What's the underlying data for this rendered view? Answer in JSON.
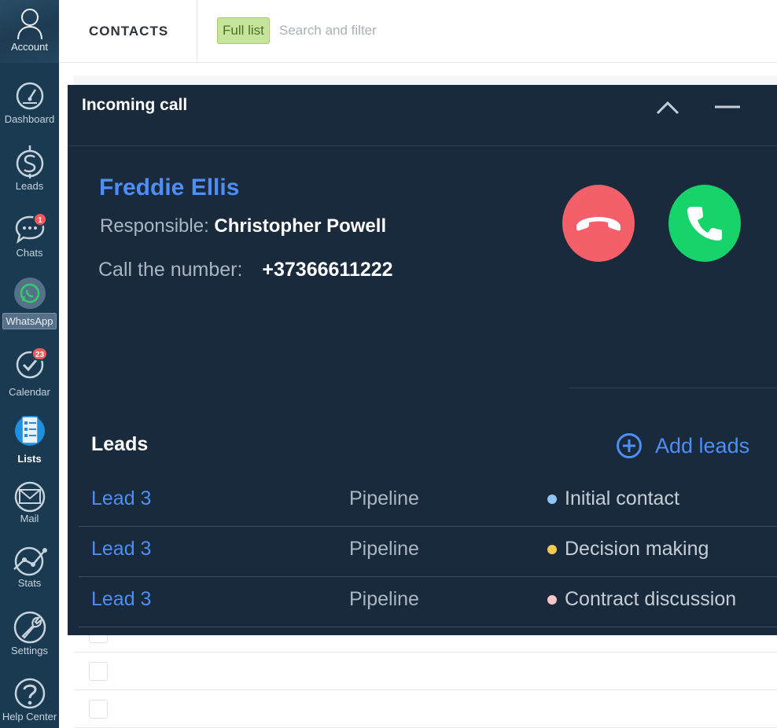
{
  "sidebar": {
    "account_label": "Account",
    "items": [
      {
        "label": "Dashboard",
        "icon": "gauge-icon"
      },
      {
        "label": "Leads",
        "icon": "dollar-icon"
      },
      {
        "label": "Chats",
        "icon": "chat-icon",
        "badge": "1"
      },
      {
        "label": "WhatsApp",
        "icon": "whatsapp-icon"
      },
      {
        "label": "Calendar",
        "icon": "check-icon",
        "badge": "23"
      },
      {
        "label": "Lists",
        "icon": "list-icon"
      },
      {
        "label": "Mail",
        "icon": "mail-icon"
      },
      {
        "label": "Stats",
        "icon": "stats-icon"
      },
      {
        "label": "Settings",
        "icon": "wrench-icon"
      },
      {
        "label": "Help Center",
        "icon": "help-icon"
      }
    ]
  },
  "header": {
    "title": "CONTACTS",
    "filter_chip": "Full list",
    "search_placeholder": "Search and filter"
  },
  "call": {
    "title": "Incoming call",
    "contact_name": "Freddie Ellis",
    "responsible_label": "Responsible:",
    "responsible_name": "Christopher Powell",
    "number_label": "Call the number:",
    "number": "+37366611222",
    "leads_title": "Leads",
    "add_leads_label": "Add leads",
    "leads": [
      {
        "name": "Lead 3",
        "pipeline": "Pipeline",
        "status": "Initial contact",
        "status_color": "#8ec5f5"
      },
      {
        "name": "Lead 3",
        "pipeline": "Pipeline",
        "status": "Decision making",
        "status_color": "#f5c753"
      },
      {
        "name": "Lead 3",
        "pipeline": "Pipeline",
        "status": "Contract discussion",
        "status_color": "#f7c6c6"
      }
    ]
  },
  "colors": {
    "sidebar_bg": "#1a3a52",
    "panel_bg": "#182a3c",
    "link_blue": "#4e8ef5",
    "decline_red": "#f4606a",
    "accept_green": "#16d36a",
    "badge_red": "#f25a5a"
  }
}
